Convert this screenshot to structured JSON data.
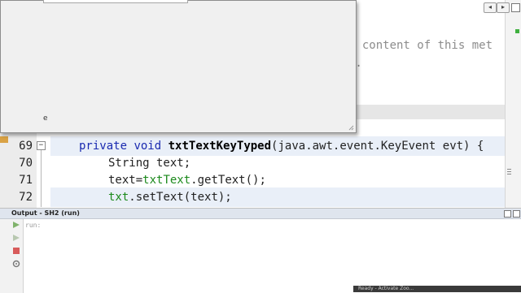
{
  "editor": {
    "comment_line1": "e content of this met",
    "comment_line2": "r.",
    "lines": [
      {
        "num": "69",
        "kw1": "private",
        "kw2": "void",
        "method": "txtTextKeyTyped",
        "rest": "(java.awt.event.KeyEvent evt) {"
      },
      {
        "num": "70",
        "text": "String text;"
      },
      {
        "num": "71",
        "lhs": "text=",
        "field": "txtText",
        "rhs": ".getText();"
      },
      {
        "num": "72",
        "field": "txt",
        "rhs": ".setText(text);"
      }
    ]
  },
  "dialog": {
    "char": "e"
  },
  "output": {
    "title": "Output - SH2 (run)",
    "text": "run:"
  },
  "taskbar": {
    "text": "Ready - Activate Zoo..."
  },
  "colors": {
    "keyword": "#1a2ab0",
    "field": "#1c8a1c",
    "highlight": "#e9eff8",
    "comment": "#8c8c8c"
  }
}
